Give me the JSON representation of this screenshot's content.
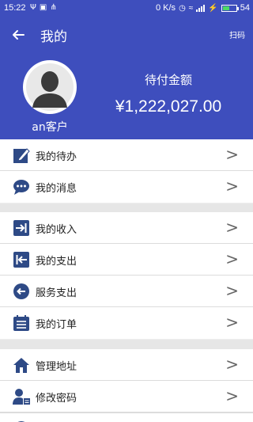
{
  "status_bar": {
    "time": "15:22",
    "network_speed": "0 K/s",
    "battery": "54",
    "battery_level": 0.54
  },
  "topbar": {
    "title": "我的",
    "scan_label": "扫码"
  },
  "profile": {
    "username": "an客户",
    "pay_label": "待付金额",
    "pay_amount": "¥1,222,027.00"
  },
  "menu": {
    "group1": [
      {
        "label": "我的待办",
        "icon": "pencil-icon"
      },
      {
        "label": "我的消息",
        "icon": "chat-icon"
      }
    ],
    "group2": [
      {
        "label": "我的收入",
        "icon": "income-icon"
      },
      {
        "label": "我的支出",
        "icon": "expense-icon"
      },
      {
        "label": "服务支出",
        "icon": "service-icon"
      },
      {
        "label": "我的订单",
        "icon": "order-icon"
      }
    ],
    "group3": [
      {
        "label": "管理地址",
        "icon": "home-icon"
      },
      {
        "label": "修改密码",
        "icon": "user-lock-icon"
      }
    ],
    "chevron": ">"
  },
  "colors": {
    "primary": "#3e4ebd",
    "icon": "#2e4a86",
    "background": "#eeeeee"
  }
}
